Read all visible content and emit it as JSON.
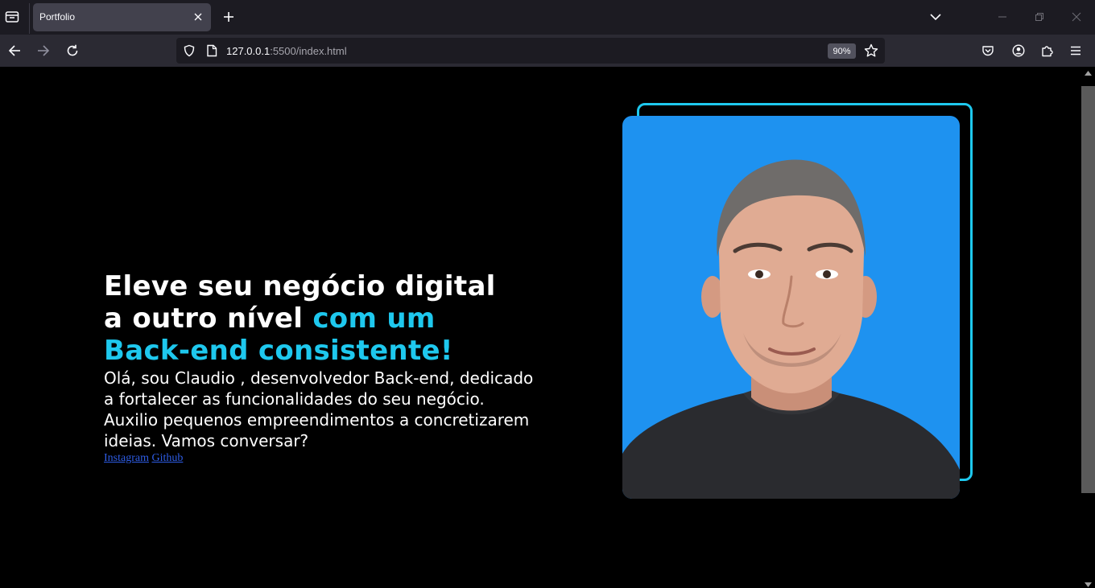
{
  "browser": {
    "tab": {
      "title": "Portfolio"
    },
    "url": {
      "host": "127.0.0.1",
      "rest": ":5500/index.html"
    },
    "zoom": "90%"
  },
  "hero": {
    "title_line1": "Eleve seu negócio digital",
    "title_line2_white": "a outro nível ",
    "title_line2_accent": "com um",
    "title_line3_accent": "Back-end consistente!",
    "description": "Olá, sou Claudio , desenvolvedor Back-end, dedicado a fortalecer as funcionalidades do seu negócio. Auxilio pequenos empreendimentos a concretizarem ideias. Vamos conversar?",
    "links": [
      {
        "label": "Instagram"
      },
      {
        "label": "Github"
      }
    ]
  },
  "colors": {
    "accent": "#1ec8ee",
    "photo_background": "#1e92f0",
    "link": "#2e5de6",
    "page_background": "#000000"
  }
}
